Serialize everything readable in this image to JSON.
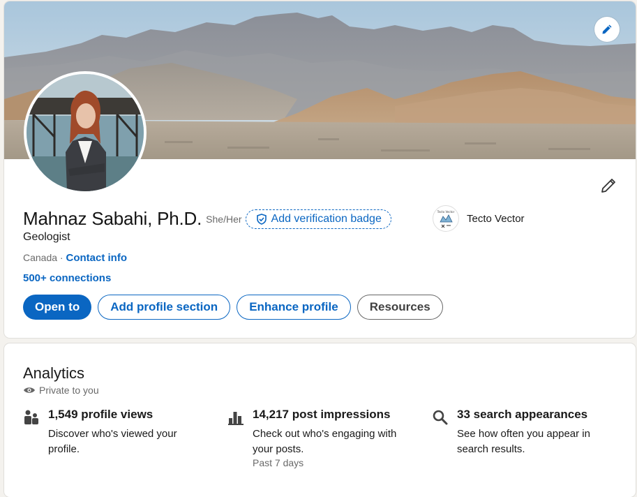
{
  "profile": {
    "name": "Mahnaz Sabahi, Ph.D.",
    "pronouns": "She/Her",
    "verification_label": "Add verification badge",
    "headline": "Geologist",
    "location": "Canada",
    "separator": " · ",
    "contact_label": "Contact info",
    "connections": "500+ connections",
    "company": {
      "name": "Tecto Vector",
      "logo_text": "Tecto Vector"
    }
  },
  "actions": {
    "open_to": "Open to",
    "add_section": "Add profile section",
    "enhance": "Enhance profile",
    "resources": "Resources"
  },
  "analytics": {
    "title": "Analytics",
    "privacy": "Private to you",
    "metrics": [
      {
        "icon": "people-icon",
        "title": "1,549 profile views",
        "description": "Discover who's viewed your profile."
      },
      {
        "icon": "bar-chart-icon",
        "title": "14,217 post impressions",
        "description": "Check out who's engaging with your posts.",
        "meta": "Past 7 days"
      },
      {
        "icon": "search-icon",
        "title": "33 search appearances",
        "description": "See how often you appear in search results."
      }
    ]
  },
  "colors": {
    "brand": "#0a66c2",
    "background": "#f4f2ee"
  }
}
